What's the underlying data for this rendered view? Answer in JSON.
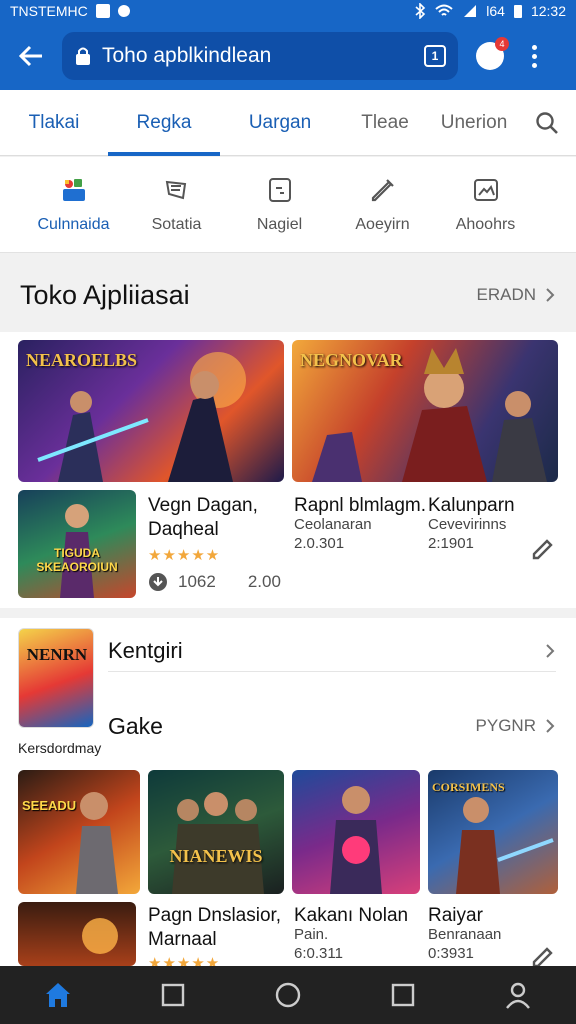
{
  "status_bar": {
    "carrier": "TNSTEMHC",
    "time": "12:32",
    "battery": "l64"
  },
  "app_bar": {
    "url_text": "Toho apblkindlean",
    "tab_count": "1",
    "notification_badge": "4"
  },
  "tabs": [
    {
      "label": "Tlakai"
    },
    {
      "label": "Regka"
    },
    {
      "label": "Uargan"
    },
    {
      "label": "Tleae"
    },
    {
      "label": "Unerion"
    }
  ],
  "categories": [
    {
      "label": "Culnnaida",
      "icon": "apps-icon"
    },
    {
      "label": "Sotatia",
      "icon": "book-icon"
    },
    {
      "label": "Nagiel",
      "icon": "device-icon"
    },
    {
      "label": "Aoeyirn",
      "icon": "pen-icon"
    },
    {
      "label": "Ahoohrs",
      "icon": "gallery-icon"
    }
  ],
  "section1": {
    "title": "Toko Ajpliiasai",
    "link": "ERADN",
    "banner_left_text": "NEAROELBS",
    "banner_right_text": "NEGNOVAR",
    "featured": {
      "thumb_text": "TIGUDA SKEAOROIUN",
      "title_line1": "Vegn Dagan,",
      "title_line2": "Daqheal",
      "stars": "★★★★★",
      "size": "1062",
      "price": "2.00"
    },
    "app2": {
      "title": "Rapnl blmlagm.",
      "sub1": "Ceolanaran",
      "sub2": "2.0.301"
    },
    "app3": {
      "title": "Kalunparn",
      "sub1": "Cevevirinns",
      "sub2": "2:1901"
    }
  },
  "section2": {
    "row1_title": "Kentgiri",
    "row2_title": "Gake",
    "link": "PYGNR",
    "subtitle": "Kersdordmay",
    "logo_text": "NENRN",
    "games": [
      {
        "art_text": "SEEADU"
      },
      {
        "art_text": "NIANEWIS"
      },
      {
        "art_text": ""
      },
      {
        "art_text": "CORSIMENS"
      }
    ],
    "list": [
      {
        "title_line1": "Pagn Dnslasior,",
        "title_line2": "Marnaal",
        "stars": "★★★★★"
      },
      {
        "title_line1": "Kakanı Nolan",
        "title_line2": "Pain.",
        "sub": "6:0.311"
      },
      {
        "title_line1": "Raiyar",
        "title_line2": "Benranaan",
        "sub": "0:3931"
      }
    ]
  },
  "colors": {
    "primary": "#1766c6",
    "accent_star": "#f2a73b",
    "nav_bg": "#222222"
  }
}
